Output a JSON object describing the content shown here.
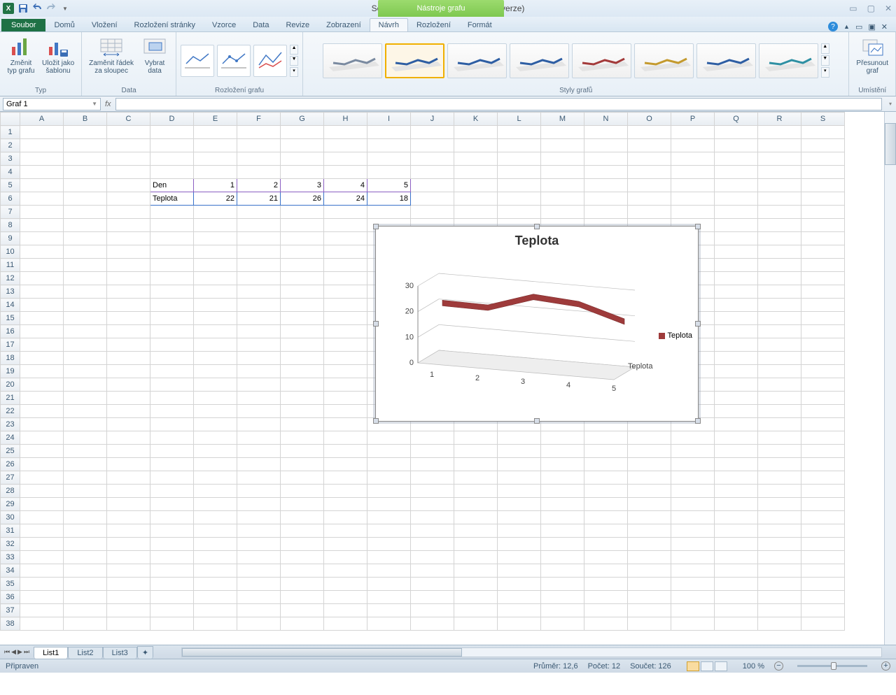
{
  "title": "Sešit1 - Microsoft Excel (Zkušební verze)",
  "chart_tools": "Nástroje grafu",
  "tabs": {
    "file": "Soubor",
    "home": "Domů",
    "insert": "Vložení",
    "layout": "Rozložení stránky",
    "formulas": "Vzorce",
    "data": "Data",
    "review": "Revize",
    "view": "Zobrazení",
    "design": "Návrh",
    "clayout": "Rozložení",
    "format": "Formát"
  },
  "ribbon": {
    "type_group": "Typ",
    "change_type": "Změnit\ntyp grafu",
    "save_template": "Uložit jako\nšablonu",
    "data_group": "Data",
    "switch_rc": "Zaměnit řádek\nza sloupec",
    "select_data": "Vybrat\ndata",
    "layouts_group": "Rozložení grafu",
    "styles_group": "Styly grafů",
    "location_group": "Umístění",
    "move_chart": "Přesunout\ngraf"
  },
  "namebox": "Graf 1",
  "columns": [
    "A",
    "B",
    "C",
    "D",
    "E",
    "F",
    "G",
    "H",
    "I",
    "J",
    "K",
    "L",
    "M",
    "N",
    "O",
    "P",
    "Q",
    "R",
    "S"
  ],
  "rows": 38,
  "cells": {
    "D5": "Den",
    "E5": "1",
    "F5": "2",
    "G5": "3",
    "H5": "4",
    "I5": "5",
    "D6": "Teplota",
    "E6": "22",
    "F6": "21",
    "G6": "26",
    "H6": "24",
    "I6": "18"
  },
  "chart_data": {
    "type": "line",
    "title": "Teplota",
    "categories": [
      "1",
      "2",
      "3",
      "4",
      "5"
    ],
    "series": [
      {
        "name": "Teplota",
        "values": [
          22,
          21,
          26,
          24,
          18
        ]
      }
    ],
    "ylabel": "",
    "xlabel": "",
    "ylim": [
      0,
      30
    ],
    "yticks": [
      0,
      10,
      20,
      30
    ],
    "depth_label": "Teplota"
  },
  "sheets": {
    "s1": "List1",
    "s2": "List2",
    "s3": "List3"
  },
  "status": {
    "ready": "Připraven",
    "avg": "Průměr: 12,6",
    "count": "Počet: 12",
    "sum": "Součet: 126",
    "zoom": "100 %"
  }
}
